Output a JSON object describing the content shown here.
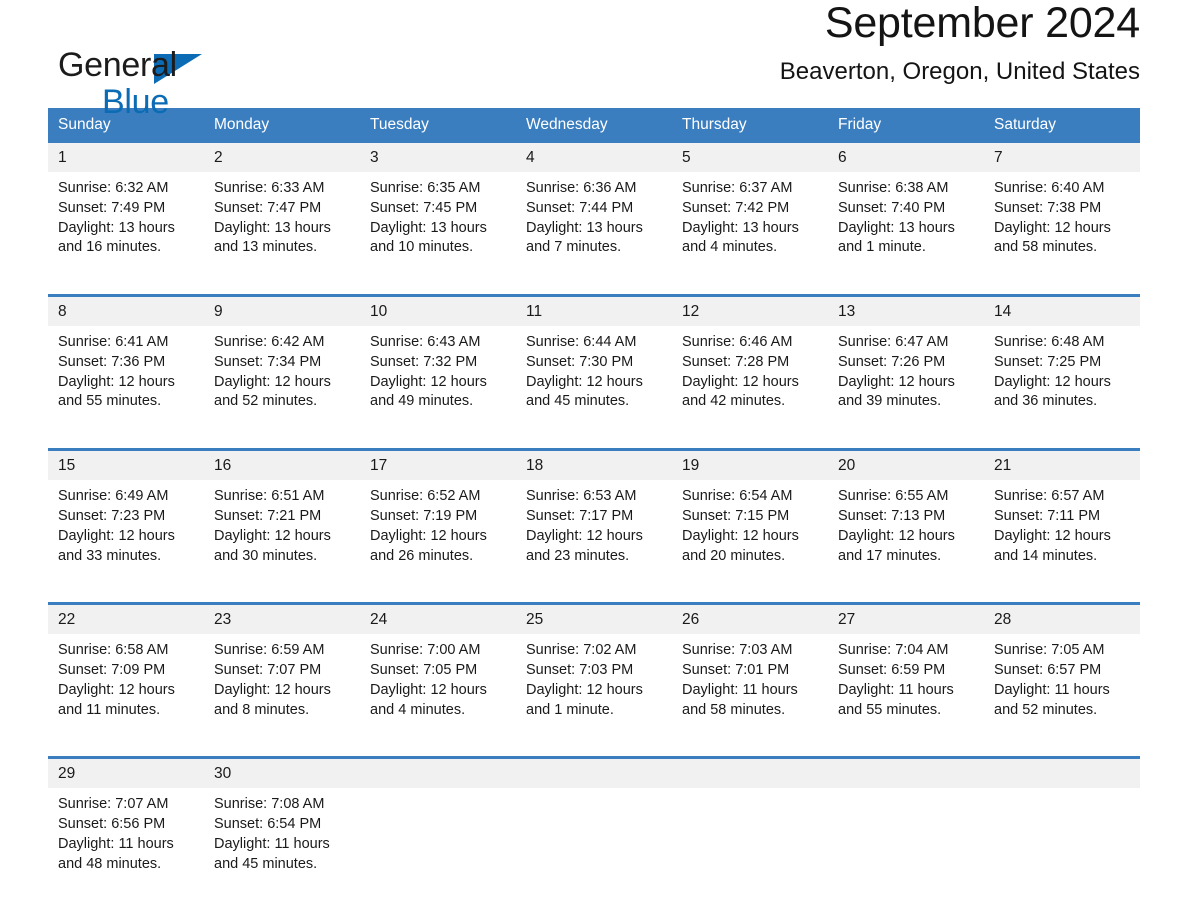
{
  "brand": {
    "name_part1": "General",
    "name_part2": "Blue",
    "flag_icon": "triangle-flag-icon"
  },
  "header": {
    "month_title": "September 2024",
    "location": "Beaverton, Oregon, United States"
  },
  "colors": {
    "accent_blue": "#3a7ebf",
    "brand_blue": "#0b6cb5",
    "daynum_background": "#f1f1f1",
    "cell_background": "#ffffff",
    "text": "#1a1a1a"
  },
  "weekdays": [
    "Sunday",
    "Monday",
    "Tuesday",
    "Wednesday",
    "Thursday",
    "Friday",
    "Saturday"
  ],
  "labels": {
    "sunrise_prefix": "Sunrise:",
    "sunset_prefix": "Sunset:",
    "daylight_prefix": "Daylight:"
  },
  "weeks": [
    {
      "days": [
        {
          "num": "1",
          "sunrise": "Sunrise: 6:32 AM",
          "sunset": "Sunset: 7:49 PM",
          "daylight_l1": "Daylight: 13 hours",
          "daylight_l2": "and 16 minutes."
        },
        {
          "num": "2",
          "sunrise": "Sunrise: 6:33 AM",
          "sunset": "Sunset: 7:47 PM",
          "daylight_l1": "Daylight: 13 hours",
          "daylight_l2": "and 13 minutes."
        },
        {
          "num": "3",
          "sunrise": "Sunrise: 6:35 AM",
          "sunset": "Sunset: 7:45 PM",
          "daylight_l1": "Daylight: 13 hours",
          "daylight_l2": "and 10 minutes."
        },
        {
          "num": "4",
          "sunrise": "Sunrise: 6:36 AM",
          "sunset": "Sunset: 7:44 PM",
          "daylight_l1": "Daylight: 13 hours",
          "daylight_l2": "and 7 minutes."
        },
        {
          "num": "5",
          "sunrise": "Sunrise: 6:37 AM",
          "sunset": "Sunset: 7:42 PM",
          "daylight_l1": "Daylight: 13 hours",
          "daylight_l2": "and 4 minutes."
        },
        {
          "num": "6",
          "sunrise": "Sunrise: 6:38 AM",
          "sunset": "Sunset: 7:40 PM",
          "daylight_l1": "Daylight: 13 hours",
          "daylight_l2": "and 1 minute."
        },
        {
          "num": "7",
          "sunrise": "Sunrise: 6:40 AM",
          "sunset": "Sunset: 7:38 PM",
          "daylight_l1": "Daylight: 12 hours",
          "daylight_l2": "and 58 minutes."
        }
      ]
    },
    {
      "days": [
        {
          "num": "8",
          "sunrise": "Sunrise: 6:41 AM",
          "sunset": "Sunset: 7:36 PM",
          "daylight_l1": "Daylight: 12 hours",
          "daylight_l2": "and 55 minutes."
        },
        {
          "num": "9",
          "sunrise": "Sunrise: 6:42 AM",
          "sunset": "Sunset: 7:34 PM",
          "daylight_l1": "Daylight: 12 hours",
          "daylight_l2": "and 52 minutes."
        },
        {
          "num": "10",
          "sunrise": "Sunrise: 6:43 AM",
          "sunset": "Sunset: 7:32 PM",
          "daylight_l1": "Daylight: 12 hours",
          "daylight_l2": "and 49 minutes."
        },
        {
          "num": "11",
          "sunrise": "Sunrise: 6:44 AM",
          "sunset": "Sunset: 7:30 PM",
          "daylight_l1": "Daylight: 12 hours",
          "daylight_l2": "and 45 minutes."
        },
        {
          "num": "12",
          "sunrise": "Sunrise: 6:46 AM",
          "sunset": "Sunset: 7:28 PM",
          "daylight_l1": "Daylight: 12 hours",
          "daylight_l2": "and 42 minutes."
        },
        {
          "num": "13",
          "sunrise": "Sunrise: 6:47 AM",
          "sunset": "Sunset: 7:26 PM",
          "daylight_l1": "Daylight: 12 hours",
          "daylight_l2": "and 39 minutes."
        },
        {
          "num": "14",
          "sunrise": "Sunrise: 6:48 AM",
          "sunset": "Sunset: 7:25 PM",
          "daylight_l1": "Daylight: 12 hours",
          "daylight_l2": "and 36 minutes."
        }
      ]
    },
    {
      "days": [
        {
          "num": "15",
          "sunrise": "Sunrise: 6:49 AM",
          "sunset": "Sunset: 7:23 PM",
          "daylight_l1": "Daylight: 12 hours",
          "daylight_l2": "and 33 minutes."
        },
        {
          "num": "16",
          "sunrise": "Sunrise: 6:51 AM",
          "sunset": "Sunset: 7:21 PM",
          "daylight_l1": "Daylight: 12 hours",
          "daylight_l2": "and 30 minutes."
        },
        {
          "num": "17",
          "sunrise": "Sunrise: 6:52 AM",
          "sunset": "Sunset: 7:19 PM",
          "daylight_l1": "Daylight: 12 hours",
          "daylight_l2": "and 26 minutes."
        },
        {
          "num": "18",
          "sunrise": "Sunrise: 6:53 AM",
          "sunset": "Sunset: 7:17 PM",
          "daylight_l1": "Daylight: 12 hours",
          "daylight_l2": "and 23 minutes."
        },
        {
          "num": "19",
          "sunrise": "Sunrise: 6:54 AM",
          "sunset": "Sunset: 7:15 PM",
          "daylight_l1": "Daylight: 12 hours",
          "daylight_l2": "and 20 minutes."
        },
        {
          "num": "20",
          "sunrise": "Sunrise: 6:55 AM",
          "sunset": "Sunset: 7:13 PM",
          "daylight_l1": "Daylight: 12 hours",
          "daylight_l2": "and 17 minutes."
        },
        {
          "num": "21",
          "sunrise": "Sunrise: 6:57 AM",
          "sunset": "Sunset: 7:11 PM",
          "daylight_l1": "Daylight: 12 hours",
          "daylight_l2": "and 14 minutes."
        }
      ]
    },
    {
      "days": [
        {
          "num": "22",
          "sunrise": "Sunrise: 6:58 AM",
          "sunset": "Sunset: 7:09 PM",
          "daylight_l1": "Daylight: 12 hours",
          "daylight_l2": "and 11 minutes."
        },
        {
          "num": "23",
          "sunrise": "Sunrise: 6:59 AM",
          "sunset": "Sunset: 7:07 PM",
          "daylight_l1": "Daylight: 12 hours",
          "daylight_l2": "and 8 minutes."
        },
        {
          "num": "24",
          "sunrise": "Sunrise: 7:00 AM",
          "sunset": "Sunset: 7:05 PM",
          "daylight_l1": "Daylight: 12 hours",
          "daylight_l2": "and 4 minutes."
        },
        {
          "num": "25",
          "sunrise": "Sunrise: 7:02 AM",
          "sunset": "Sunset: 7:03 PM",
          "daylight_l1": "Daylight: 12 hours",
          "daylight_l2": "and 1 minute."
        },
        {
          "num": "26",
          "sunrise": "Sunrise: 7:03 AM",
          "sunset": "Sunset: 7:01 PM",
          "daylight_l1": "Daylight: 11 hours",
          "daylight_l2": "and 58 minutes."
        },
        {
          "num": "27",
          "sunrise": "Sunrise: 7:04 AM",
          "sunset": "Sunset: 6:59 PM",
          "daylight_l1": "Daylight: 11 hours",
          "daylight_l2": "and 55 minutes."
        },
        {
          "num": "28",
          "sunrise": "Sunrise: 7:05 AM",
          "sunset": "Sunset: 6:57 PM",
          "daylight_l1": "Daylight: 11 hours",
          "daylight_l2": "and 52 minutes."
        }
      ]
    },
    {
      "days": [
        {
          "num": "29",
          "sunrise": "Sunrise: 7:07 AM",
          "sunset": "Sunset: 6:56 PM",
          "daylight_l1": "Daylight: 11 hours",
          "daylight_l2": "and 48 minutes."
        },
        {
          "num": "30",
          "sunrise": "Sunrise: 7:08 AM",
          "sunset": "Sunset: 6:54 PM",
          "daylight_l1": "Daylight: 11 hours",
          "daylight_l2": "and 45 minutes."
        },
        null,
        null,
        null,
        null,
        null
      ]
    }
  ]
}
